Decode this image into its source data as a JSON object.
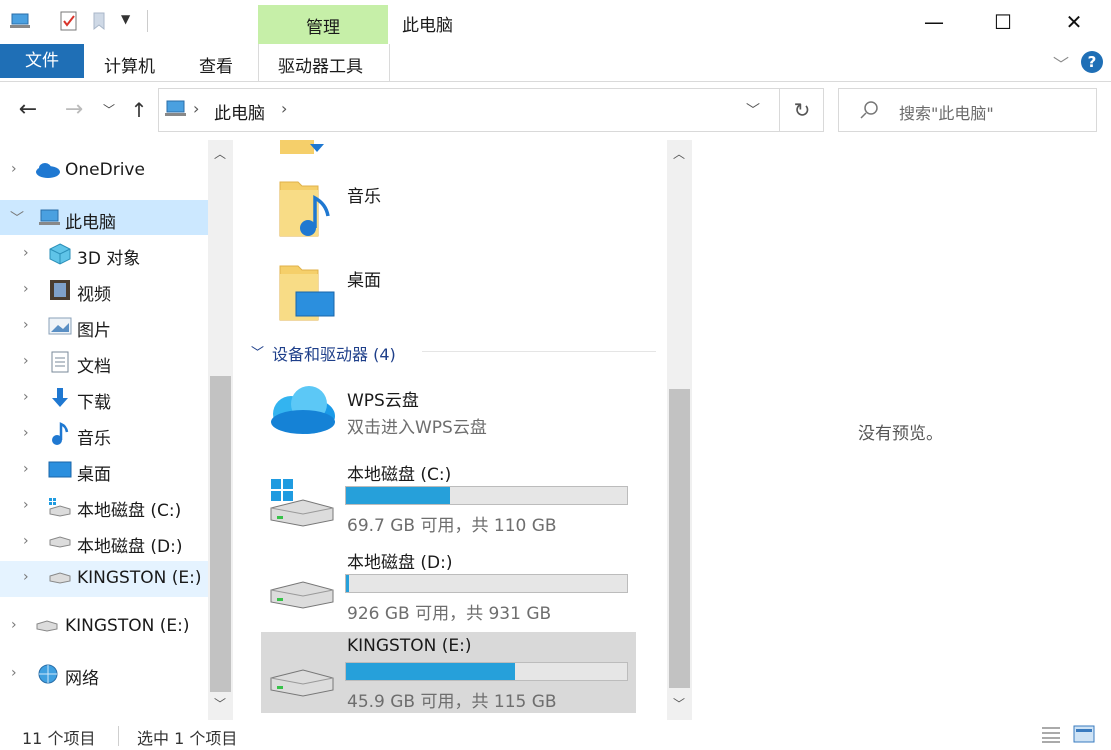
{
  "window": {
    "title": "此电脑",
    "manage_tab": "管理",
    "controls": {
      "minimize": "—",
      "maximize": "☐",
      "close": "✕"
    }
  },
  "ribbon": {
    "tabs": {
      "file": "文件",
      "computer": "计算机",
      "view": "查看",
      "drive_tools": "驱动器工具"
    },
    "help": "?"
  },
  "address": {
    "path": "此电脑",
    "search_placeholder": "搜索\"此电脑\""
  },
  "sidebar": {
    "items": [
      {
        "label": "OneDrive",
        "icon": "onedrive-icon"
      },
      {
        "label": "此电脑",
        "icon": "this-pc-icon"
      },
      {
        "label": "3D 对象",
        "icon": "3d-objects-icon"
      },
      {
        "label": "视频",
        "icon": "video-icon"
      },
      {
        "label": "图片",
        "icon": "pictures-icon"
      },
      {
        "label": "文档",
        "icon": "documents-icon"
      },
      {
        "label": "下载",
        "icon": "download-icon"
      },
      {
        "label": "音乐",
        "icon": "music-icon"
      },
      {
        "label": "桌面",
        "icon": "desktop-icon"
      },
      {
        "label": "本地磁盘 (C:)",
        "icon": "drive-c-icon"
      },
      {
        "label": "本地磁盘 (D:)",
        "icon": "drive-d-icon"
      },
      {
        "label": "KINGSTON (E:)",
        "icon": "usb-drive-icon"
      },
      {
        "label": "KINGSTON (E:)",
        "icon": "usb-drive-icon"
      },
      {
        "label": "网络",
        "icon": "network-icon"
      }
    ]
  },
  "content": {
    "folders": [
      {
        "label": "音乐",
        "icon": "music-folder-icon"
      },
      {
        "label": "桌面",
        "icon": "desktop-folder-icon"
      }
    ],
    "group_header": "设备和驱动器 (4)",
    "cloud": {
      "name": "WPS云盘",
      "sub": "双击进入WPS云盘"
    },
    "drives": [
      {
        "name": "本地磁盘 (C:)",
        "sub": "69.7 GB 可用，共 110 GB",
        "used_fraction": 0.37
      },
      {
        "name": "本地磁盘 (D:)",
        "sub": "926 GB 可用，共 931 GB",
        "used_fraction": 0.01
      },
      {
        "name": "KINGSTON (E:)",
        "sub": "45.9 GB 可用，共 115 GB",
        "used_fraction": 0.6
      }
    ]
  },
  "preview": {
    "text": "没有预览。"
  },
  "status": {
    "item_count": "11 个项目",
    "selected": "选中 1 个项目"
  },
  "colors": {
    "accent": "#1f6fb6",
    "manage_tab": "#c6efa8",
    "drive_fill": "#26a0da",
    "selection": "#cce8ff"
  }
}
